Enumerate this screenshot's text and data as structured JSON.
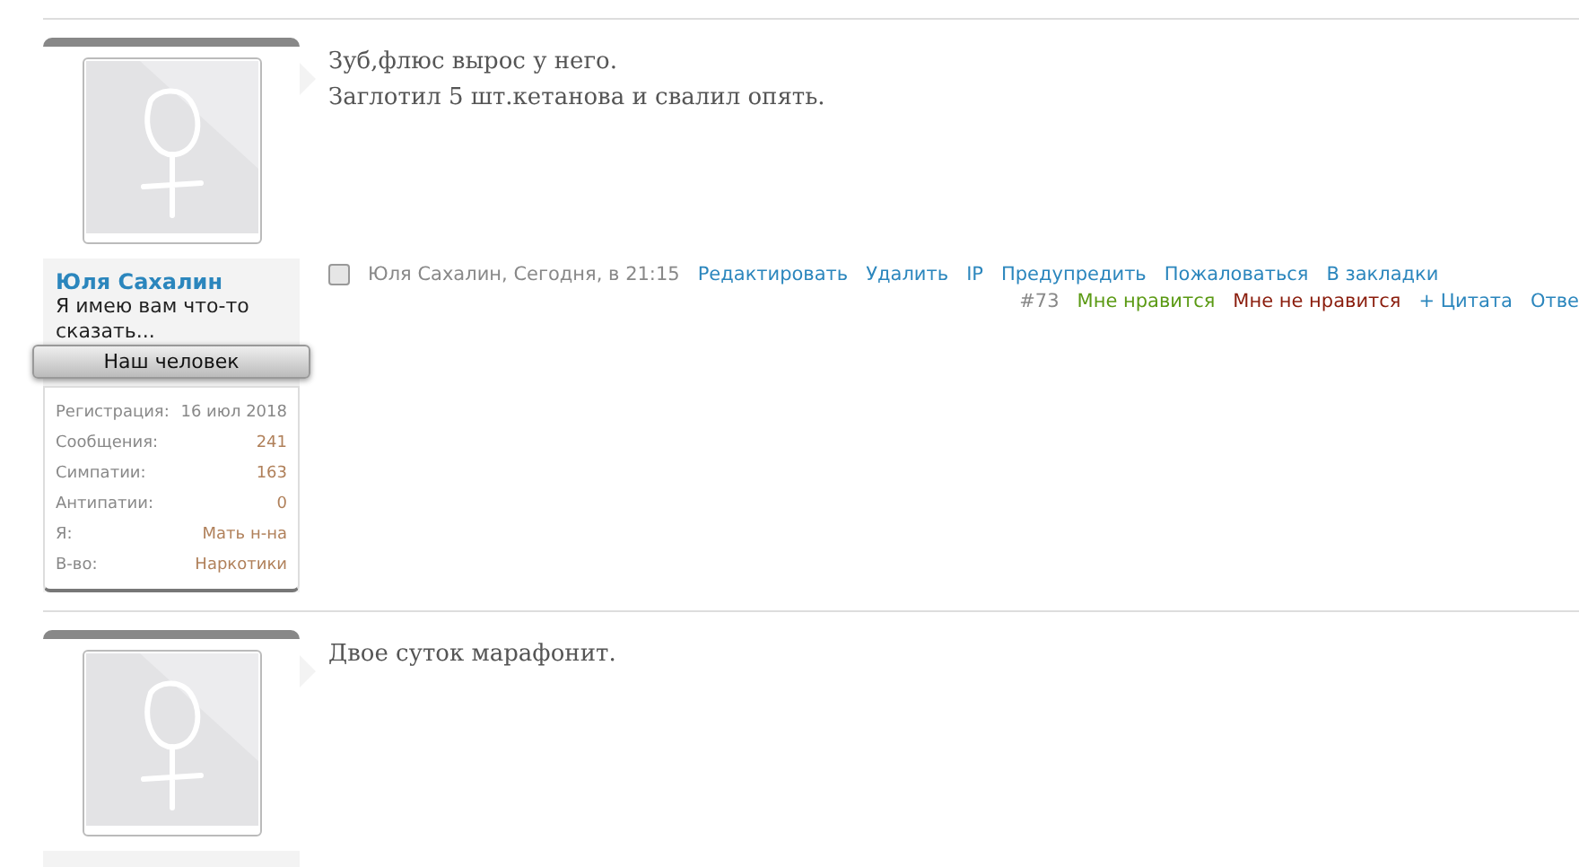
{
  "posts": [
    {
      "author": {
        "name": "Юля Сахалин",
        "title": "Я имею вам что-то сказать...",
        "banner": "Наш человек",
        "stats": [
          {
            "label": "Регистрация:",
            "value": "16 июл 2018",
            "kind": "plain"
          },
          {
            "label": "Сообщения:",
            "value": "241",
            "kind": "link"
          },
          {
            "label": "Симпатии:",
            "value": "163",
            "kind": "link"
          },
          {
            "label": "Антипатии:",
            "value": "0",
            "kind": "link"
          },
          {
            "label": "Я:",
            "value": "Мать н-на",
            "kind": "link"
          },
          {
            "label": "В-во:",
            "value": "Наркотики",
            "kind": "link"
          }
        ]
      },
      "message": [
        "Зуб,флюс вырос у него.",
        "Заглотил 5 шт.кетанова и свалил опять."
      ],
      "checked": false,
      "meta": "Юля Сахалин, Сегодня, в 21:15",
      "controls": [
        "Редактировать",
        "Удалить",
        "IP",
        "Предупредить",
        "Пожаловаться",
        "В закладки"
      ],
      "footer": [
        {
          "text": "#73",
          "kind": "number"
        },
        {
          "text": "Мне нравится",
          "kind": "like"
        },
        {
          "text": "Мне не нравится",
          "kind": "dislike"
        },
        {
          "text": "+ Цитата",
          "kind": "link"
        },
        {
          "text": "Отве",
          "kind": "link"
        }
      ]
    },
    {
      "message": [
        "Двое суток марафонит."
      ]
    }
  ]
}
